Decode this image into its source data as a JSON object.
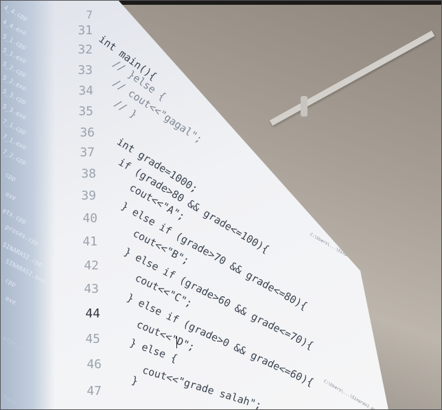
{
  "sidebar_files": [
    "4_4.cpp",
    "4_4.exe",
    "5_1.cpp",
    "5_1.exe",
    "5_2.cpp",
    "5_2.exe",
    "5_3.cpp",
    "5_3.exe",
    "7_1.cpp",
    "7_1.exe",
    "7_2.cpp",
    "cpp",
    "exe",
    "ets.cpp",
    "proses.cpp",
    "SINARASI.cpp",
    "SINARASI.exe",
    "cpp",
    "exe",
    "atbelas",
    "face"
  ],
  "line_numbers": [
    "7",
    "31",
    "32",
    "33",
    "34",
    "35",
    "36",
    "37",
    "38",
    "39",
    "40",
    "41",
    "42",
    "43",
    "44",
    "45",
    "46",
    "47"
  ],
  "code_lines": [
    "int main(){",
    "// }else {",
    "//   cout<<\"gagal\";",
    "// }",
    "int grade=1000;",
    "if (grade>80 && grade<=100){",
    "  cout<<\"A\";",
    "} else if (grade>70 && grade<=80){",
    "  cout<<\"B\";",
    "} else if (grade>60 && grade<=70){",
    "  cout<<\"C\";",
    "} else if (grade>0 && grade<=60){",
    "  cout<<\"D\";",
    "} else {",
    "  cout<<\"grade salah\";",
    "}"
  ],
  "minimap_text": [
    "C:\\Users\\...\\Sinarasi.cpp",
    "C:\\Users\\...\\Sinarasi.exe"
  ]
}
